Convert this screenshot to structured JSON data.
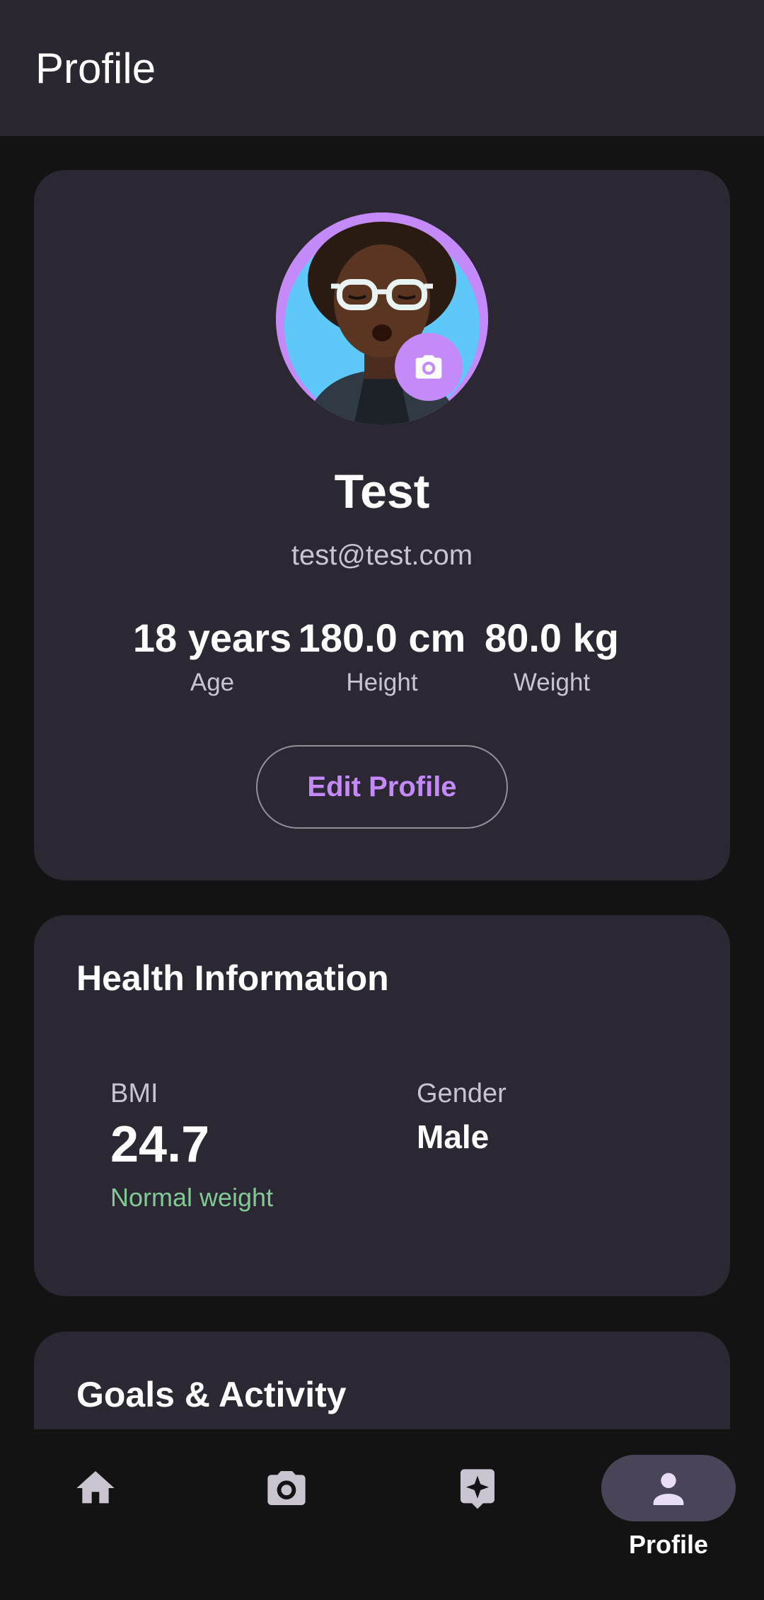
{
  "appbar": {
    "title": "Profile"
  },
  "profile": {
    "name": "Test",
    "email": "test@test.com",
    "stats": [
      {
        "value": "18 years",
        "label": "Age"
      },
      {
        "value": "180.0 cm",
        "label": "Height"
      },
      {
        "value": "80.0 kg",
        "label": "Weight"
      }
    ],
    "edit_button": "Edit Profile",
    "avatar_icon": "memoji-avatar",
    "camera_icon": "camera-icon"
  },
  "health": {
    "title": "Health Information",
    "bmi_label": "BMI",
    "bmi_value": "24.7",
    "bmi_status": "Normal weight",
    "gender_label": "Gender",
    "gender_value": "Male"
  },
  "goals": {
    "title": "Goals & Activity"
  },
  "nav": {
    "items": [
      {
        "icon": "home-icon",
        "label": ""
      },
      {
        "icon": "camera-icon",
        "label": ""
      },
      {
        "icon": "sparkle-icon",
        "label": ""
      },
      {
        "icon": "person-icon",
        "label": "Profile"
      }
    ],
    "active_index": 3
  },
  "colors": {
    "accent": "#c58af9",
    "card": "#2b2733",
    "background": "#131313",
    "appbar": "#2a2730",
    "success": "#81c995"
  }
}
